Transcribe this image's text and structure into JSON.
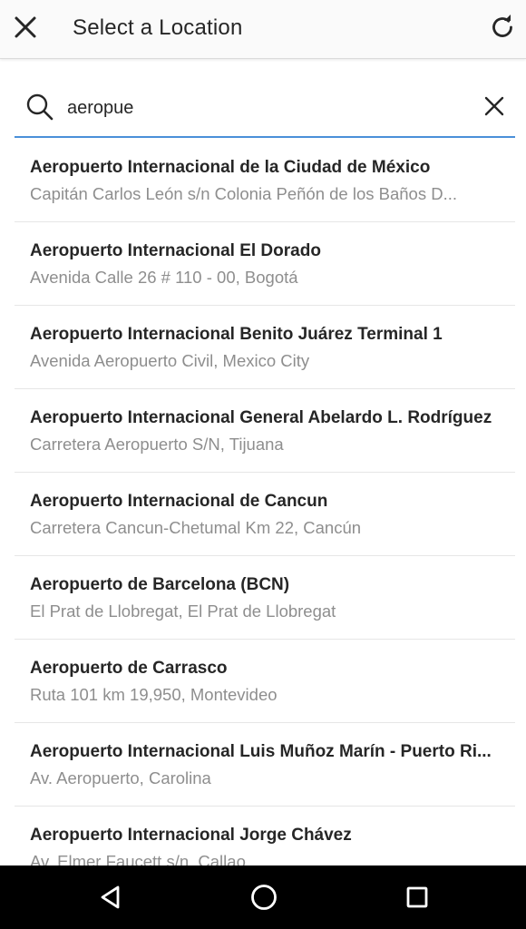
{
  "header": {
    "title": "Select a Location",
    "close_icon": "close-icon",
    "refresh_icon": "refresh-icon"
  },
  "search": {
    "value": "aeropue",
    "search_icon": "search-icon",
    "clear_icon": "clear-icon"
  },
  "results": [
    {
      "name": "Aeropuerto Internacional de la Ciudad de México",
      "address": "Capitán Carlos León s/n Colonia Peñón de los Baños D..."
    },
    {
      "name": "Aeropuerto Internacional El Dorado",
      "address": "Avenida Calle 26 # 110 - 00, Bogotá"
    },
    {
      "name": "Aeropuerto Internacional Benito Juárez Terminal 1",
      "address": "Avenida Aeropuerto Civil, Mexico City"
    },
    {
      "name": "Aeropuerto Internacional General Abelardo L. Rodríguez",
      "address": "Carretera Aeropuerto S/N, Tijuana"
    },
    {
      "name": "Aeropuerto Internacional de Cancun",
      "address": "Carretera Cancun-Chetumal Km 22, Cancún"
    },
    {
      "name": "Aeropuerto de Barcelona (BCN)",
      "address": "El Prat de Llobregat, El Prat de Llobregat"
    },
    {
      "name": "Aeropuerto de Carrasco",
      "address": "Ruta 101 km 19,950, Montevideo"
    },
    {
      "name": "Aeropuerto Internacional Luis Muñoz Marín - Puerto Ri...",
      "address": "Av. Aeropuerto, Carolina"
    },
    {
      "name": "Aeropuerto Internacional Jorge Chávez",
      "address": "Av. Elmer Faucett s/n, Callao"
    }
  ],
  "nav": {
    "back_icon": "back-triangle-icon",
    "home_icon": "home-circle-icon",
    "recents_icon": "recents-square-icon"
  },
  "colors": {
    "accent": "#4a90d9",
    "text_primary": "#262626",
    "text_secondary": "#8e8e8e",
    "divider": "#e6e6e6",
    "nav_bar": "#000000"
  }
}
